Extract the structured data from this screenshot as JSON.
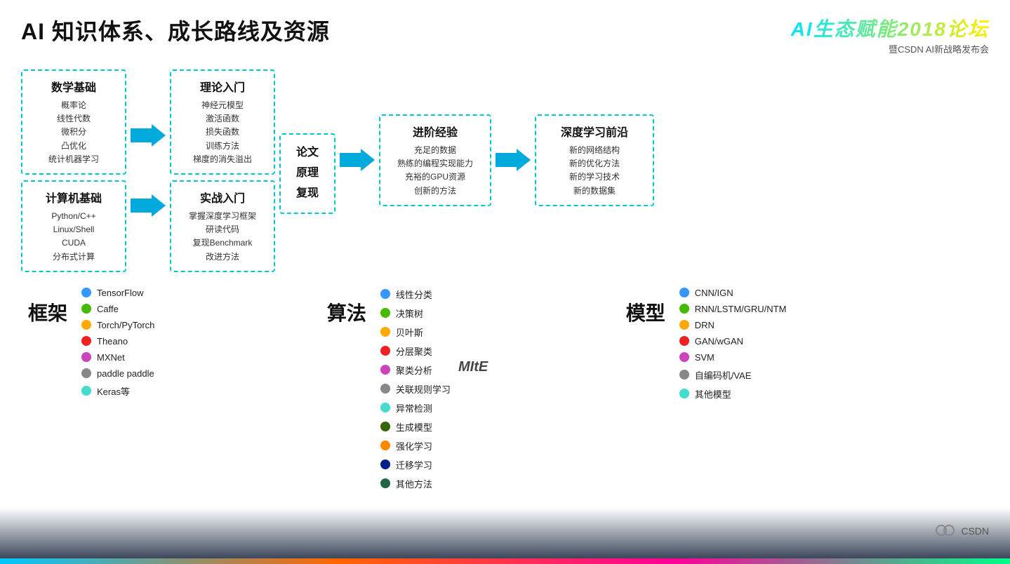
{
  "header": {
    "main_title": "AI 知识体系、成长路线及资源",
    "logo_title": "AI生态赋能2018论坛",
    "logo_subtitle": "暨CSDN AI新战略发布会"
  },
  "flow": {
    "box1": {
      "title": "数学基础",
      "items": [
        "概率论",
        "线性代数",
        "微积分",
        "凸优化",
        "统计机器学习"
      ]
    },
    "box2": {
      "title": "计算机基础",
      "items": [
        "Python/C++",
        "Linux/Shell",
        "CUDA",
        "分布式计算"
      ]
    },
    "box3": {
      "title": "理论入门",
      "items": [
        "神经元模型",
        "激活函数",
        "损失函数",
        "训练方法",
        "梯度的消失溢出"
      ]
    },
    "box4": {
      "title": "实战入门",
      "items": [
        "掌握深度学习框架",
        "研读代码",
        "复现Benchmark",
        "改进方法"
      ]
    },
    "box_paper": {
      "lines": [
        "论文",
        "原理",
        "复现"
      ]
    },
    "box5": {
      "title": "进阶经验",
      "items": [
        "充足的数据",
        "熟练的编程实现能力",
        "充裕的GPU资源",
        "创新的方法"
      ]
    },
    "box6": {
      "title": "深度学习前沿",
      "items": [
        "新的网络结构",
        "新的优化方法",
        "新的学习技术",
        "新的数据集"
      ]
    }
  },
  "frameworks": {
    "label": "框架",
    "items": [
      {
        "color": "#3399ff",
        "text": "TensorFlow"
      },
      {
        "color": "#44bb00",
        "text": "Caffe"
      },
      {
        "color": "#ffaa00",
        "text": "Torch/PyTorch"
      },
      {
        "color": "#ee2222",
        "text": "Theano"
      },
      {
        "color": "#cc44bb",
        "text": "MXNet"
      },
      {
        "color": "#888888",
        "text": "paddle paddle"
      },
      {
        "color": "#44ddcc",
        "text": "Keras等"
      }
    ]
  },
  "algorithms": {
    "label": "算法",
    "items": [
      {
        "color": "#3399ff",
        "text": "线性分类"
      },
      {
        "color": "#44bb00",
        "text": "决策树"
      },
      {
        "color": "#ffaa00",
        "text": "贝叶斯"
      },
      {
        "color": "#ee2222",
        "text": "分层聚类"
      },
      {
        "color": "#cc44bb",
        "text": "聚类分析"
      },
      {
        "color": "#888888",
        "text": "关联规则学习"
      },
      {
        "color": "#44ddcc",
        "text": "异常检测"
      },
      {
        "color": "#336600",
        "text": "生成模型"
      },
      {
        "color": "#ff8800",
        "text": "强化学习"
      },
      {
        "color": "#002288",
        "text": "迁移学习"
      },
      {
        "color": "#226644",
        "text": "其他方法"
      }
    ]
  },
  "models": {
    "label": "模型",
    "items": [
      {
        "color": "#3399ff",
        "text": "CNN/IGN"
      },
      {
        "color": "#44bb00",
        "text": "RNN/LSTM/GRU/NTM"
      },
      {
        "color": "#ffaa00",
        "text": "DRN"
      },
      {
        "color": "#ee2222",
        "text": "GAN/wGAN"
      },
      {
        "color": "#cc44bb",
        "text": "SVM"
      },
      {
        "color": "#888888",
        "text": "自编码机/VAE"
      },
      {
        "color": "#44ddcc",
        "text": "其他模型"
      }
    ]
  },
  "mit_label": "MItE",
  "csdn_label": "CSDN"
}
